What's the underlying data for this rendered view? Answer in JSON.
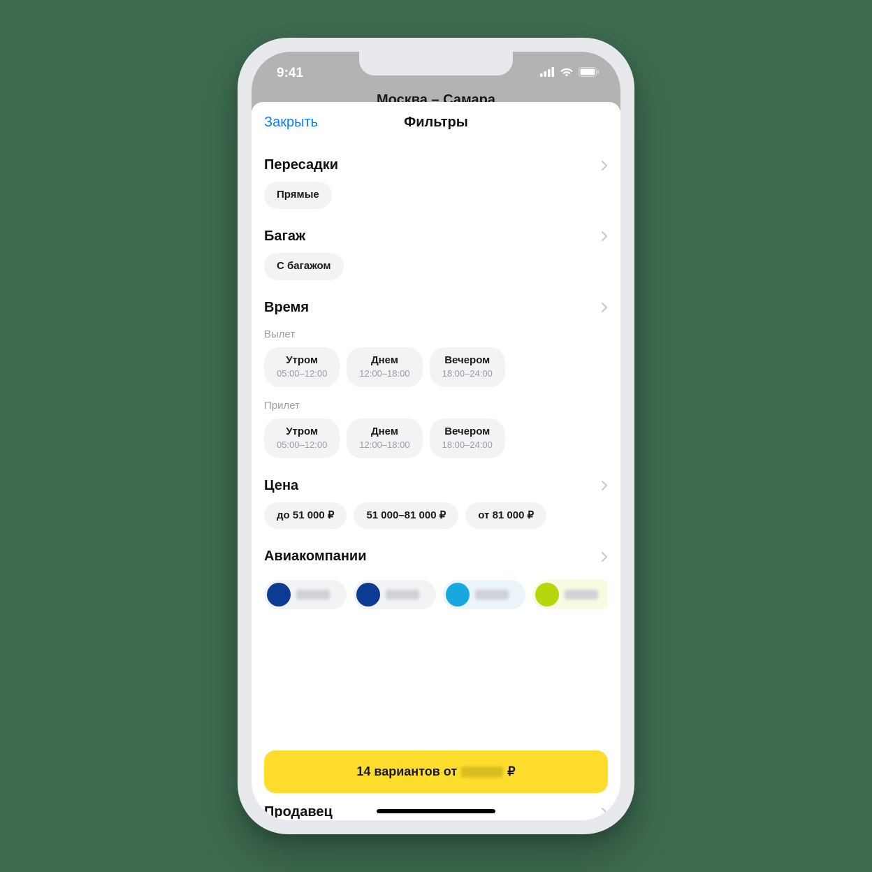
{
  "statusbar": {
    "time": "9:41"
  },
  "behind_header": "Москва – Самара",
  "sheet": {
    "close_label": "Закрыть",
    "title": "Фильтры"
  },
  "sections": {
    "transfers": {
      "title": "Пересадки",
      "chips": [
        "Прямые"
      ]
    },
    "baggage": {
      "title": "Багаж",
      "chips": [
        "С багажом"
      ]
    },
    "time": {
      "title": "Время",
      "depart_label": "Вылет",
      "arrive_label": "Прилет",
      "slots": [
        {
          "name": "Утром",
          "range": "05:00–12:00"
        },
        {
          "name": "Днем",
          "range": "12:00–18:00"
        },
        {
          "name": "Вечером",
          "range": "18:00–24:00"
        }
      ]
    },
    "price": {
      "title": "Цена",
      "chips": [
        "до 51 000 ₽",
        "51 000–81 000 ₽",
        "от 81 000 ₽"
      ]
    },
    "airlines": {
      "title": "Авиакомпании",
      "items": [
        {
          "color": "#0b3c91"
        },
        {
          "color": "#0b3c91"
        },
        {
          "color": "#19a7e0"
        },
        {
          "color": "#b7d60b"
        }
      ]
    },
    "seller": {
      "title": "Продавец"
    }
  },
  "cta": {
    "prefix": "14 вариантов от",
    "suffix": "₽"
  }
}
